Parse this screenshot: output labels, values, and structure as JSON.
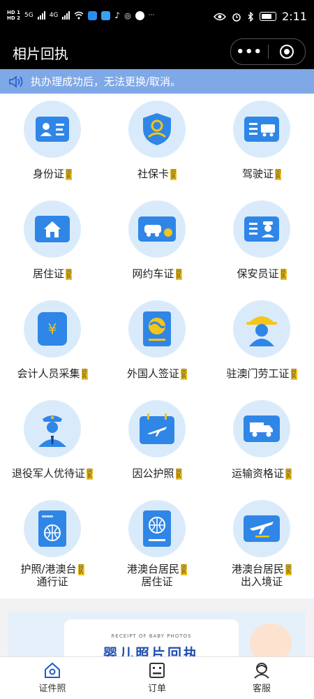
{
  "status_bar": {
    "hd1": "HD 1",
    "hd2": "HD 2",
    "net1": "5G",
    "net2": "4G",
    "more": "···",
    "time": "2:11"
  },
  "title_bar": {
    "title": "相片回执",
    "more_label": "•••"
  },
  "notice": {
    "text": "执办理成功后，无法更换/取消。"
  },
  "badge_text": "回执",
  "services": [
    {
      "label": "身份证",
      "icon": "id-card-icon"
    },
    {
      "label": "社保卡",
      "icon": "social-security-shield-icon"
    },
    {
      "label": "驾驶证",
      "icon": "driver-license-icon"
    },
    {
      "label": "居住证",
      "icon": "residence-house-icon"
    },
    {
      "label": "网约车证",
      "icon": "ride-hailing-car-icon"
    },
    {
      "label": "保安员证",
      "icon": "security-guard-card-icon"
    },
    {
      "label": "会计人员采集",
      "icon": "accountant-yuan-icon"
    },
    {
      "label": "外国人签证",
      "icon": "foreigner-visa-icon"
    },
    {
      "label": "驻澳门劳工证",
      "icon": "macau-worker-helmet-icon"
    },
    {
      "label": "退役军人优待证",
      "icon": "veteran-officer-icon"
    },
    {
      "label": "因公护照",
      "icon": "official-passport-calendar-icon"
    },
    {
      "label": "运输资格证",
      "icon": "transport-truck-icon"
    },
    {
      "label_line1": "护照/港澳台",
      "label_line2": "通行证",
      "icon": "passport-icon"
    },
    {
      "label_line1": "港澳台居民",
      "label_line2": "居住证",
      "icon": "resident-globe-book-icon"
    },
    {
      "label_line1": "港澳台居民",
      "label_line2": "出入境证",
      "icon": "entry-exit-plane-icon"
    }
  ],
  "banner": {
    "subtitle": "RECEIPT OF BABY PHOTOS",
    "title": "婴儿照片回执"
  },
  "bottom_nav": [
    {
      "label": "证件照",
      "icon": "home-icon"
    },
    {
      "label": "订单",
      "icon": "order-list-icon"
    },
    {
      "label": "客服",
      "icon": "customer-service-icon"
    }
  ],
  "colors": {
    "accent": "#2f86e6",
    "notice_bg": "#7fa8e6",
    "icon_circle": "#d9ebfb",
    "badge": "#f5c518"
  }
}
